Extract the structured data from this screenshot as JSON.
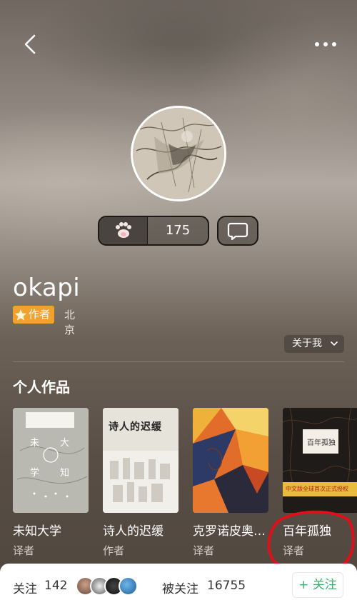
{
  "profile": {
    "username": "okapi",
    "badge_label": "作者",
    "location": "北京",
    "paw_count": "175",
    "about_label": "关于我"
  },
  "works": {
    "section_title": "个人作品",
    "items": [
      {
        "title": "未知大学",
        "role": "译者"
      },
      {
        "title": "诗人的迟缓",
        "role": "作者"
      },
      {
        "title": "克罗诺皮奥…",
        "role": "译者"
      },
      {
        "title": "百年孤独",
        "role": "译者"
      }
    ],
    "cover_text": {
      "book1": [
        "未",
        "大",
        "学",
        "知"
      ],
      "book2": "诗人的迟缓",
      "book4_top": "百年孤独",
      "book4_strip": "中文版全球首次正式授权"
    }
  },
  "bottom_bar": {
    "following_label": "关注",
    "following_count": "142",
    "followers_label": "被关注",
    "followers_count": "16755",
    "follow_button": "+ 关注"
  },
  "icons": {
    "back": "chevron-left-icon",
    "more": "more-dots-icon",
    "paw": "paw-icon",
    "message": "message-bubble-icon",
    "star": "star-icon",
    "about_chevron": "chevron-down-icon"
  },
  "colors": {
    "badge": "#f1a12e",
    "follow_accent": "#3fb16f",
    "annotation": "#e0101a"
  }
}
